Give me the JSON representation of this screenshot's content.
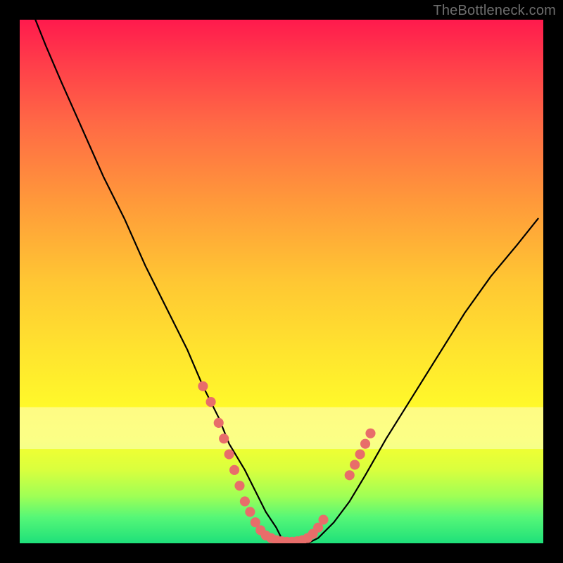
{
  "watermark": "TheBottleneck.com",
  "chart_data": {
    "type": "line",
    "title": "",
    "xlabel": "",
    "ylabel": "",
    "xlim": [
      0,
      100
    ],
    "ylim": [
      0,
      100
    ],
    "series": [
      {
        "name": "bottleneck-curve",
        "x": [
          3,
          5,
          8,
          12,
          16,
          20,
          24,
          28,
          32,
          35,
          38,
          40,
          43,
          45,
          47,
          49,
          50,
          52,
          55,
          57,
          60,
          63,
          66,
          70,
          75,
          80,
          85,
          90,
          95,
          99
        ],
        "y": [
          100,
          95,
          88,
          79,
          70,
          62,
          53,
          45,
          37,
          30,
          24,
          19,
          14,
          10,
          6,
          3,
          1,
          0,
          0,
          1,
          4,
          8,
          13,
          20,
          28,
          36,
          44,
          51,
          57,
          62
        ]
      }
    ],
    "highlight_points": {
      "name": "curve-dots",
      "color": "#e86d6a",
      "points": [
        {
          "x": 35,
          "y": 30
        },
        {
          "x": 36.5,
          "y": 27
        },
        {
          "x": 38,
          "y": 23
        },
        {
          "x": 39,
          "y": 20
        },
        {
          "x": 40,
          "y": 17
        },
        {
          "x": 41,
          "y": 14
        },
        {
          "x": 42,
          "y": 11
        },
        {
          "x": 43,
          "y": 8
        },
        {
          "x": 44,
          "y": 6
        },
        {
          "x": 45,
          "y": 4
        },
        {
          "x": 46,
          "y": 2.5
        },
        {
          "x": 47,
          "y": 1.5
        },
        {
          "x": 48,
          "y": 1
        },
        {
          "x": 49,
          "y": 0.6
        },
        {
          "x": 50,
          "y": 0.4
        },
        {
          "x": 51,
          "y": 0.3
        },
        {
          "x": 52,
          "y": 0.3
        },
        {
          "x": 53,
          "y": 0.4
        },
        {
          "x": 54,
          "y": 0.6
        },
        {
          "x": 55,
          "y": 1
        },
        {
          "x": 56,
          "y": 1.8
        },
        {
          "x": 57,
          "y": 3
        },
        {
          "x": 58,
          "y": 4.5
        },
        {
          "x": 63,
          "y": 13
        },
        {
          "x": 64,
          "y": 15
        },
        {
          "x": 65,
          "y": 17
        },
        {
          "x": 66,
          "y": 19
        },
        {
          "x": 67,
          "y": 21
        }
      ]
    },
    "haze_band": {
      "y_top": 74,
      "y_bottom": 82,
      "opacity": 0.42,
      "color": "#ffffff"
    }
  }
}
